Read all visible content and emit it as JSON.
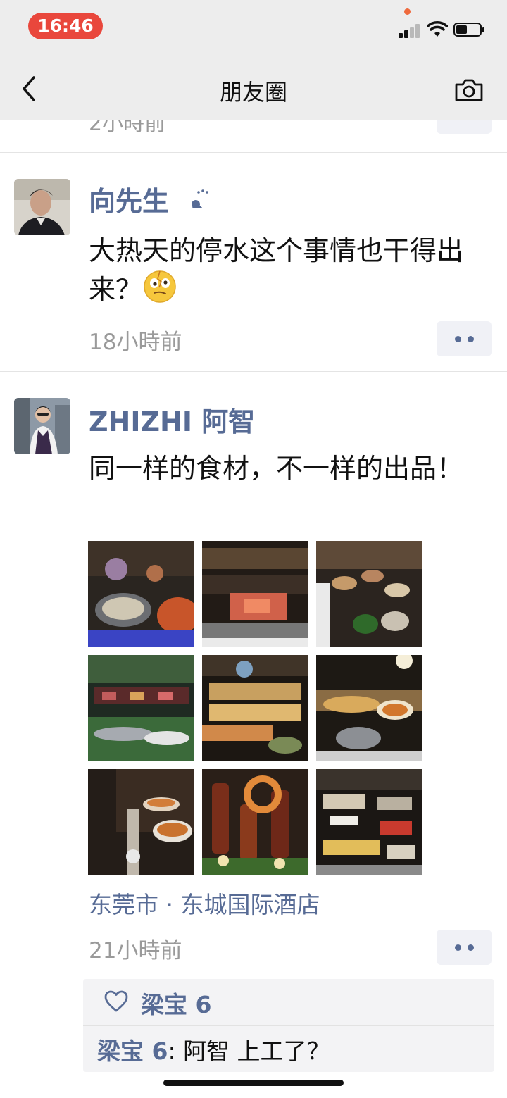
{
  "status_bar": {
    "time": "16:46"
  },
  "nav": {
    "title": "朋友圈"
  },
  "previous_post": {
    "time": "2小時前"
  },
  "posts": [
    {
      "author": "向先生",
      "text": "大热天的停水这个事情也干得出来？",
      "time": "18小時前"
    },
    {
      "author": "ZHIZHI 阿智",
      "text": "同一样的食材，不一样的出品！",
      "location": "东莞市 · 东城国际酒店",
      "time": "21小時前",
      "likes": [
        "梁宝 6"
      ],
      "comments": [
        {
          "name": "梁宝 6",
          "separator": ": ",
          "text": "阿智  上工了？"
        }
      ]
    }
  ],
  "colors": {
    "link": "#576b95",
    "time_pill": "#e9473c",
    "nav_bg": "#ededed"
  }
}
